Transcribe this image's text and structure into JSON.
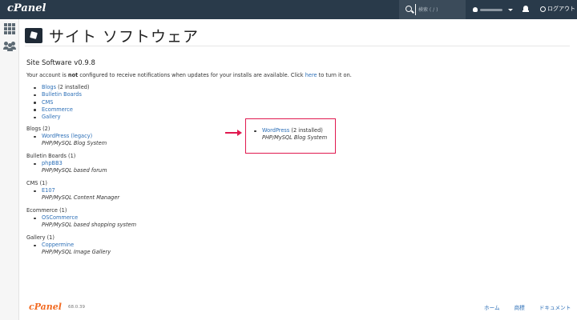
{
  "topbar": {
    "logo": "cPanel",
    "search_placeholder": "検索 ( / )",
    "logout_label": "ログアウト"
  },
  "page": {
    "title": "サイト ソフトウェア"
  },
  "main": {
    "heading": "Site Software v0.9.8",
    "notice_before": "Your account is ",
    "notice_bold": "not",
    "notice_middle": " configured to receive notifications when updates for your installs are available. Click ",
    "notice_link": "here",
    "notice_after": " to turn it on.",
    "category_links": [
      {
        "label": "Blogs",
        "suffix": " (2 installed)"
      },
      {
        "label": "Bulletin Boards",
        "suffix": ""
      },
      {
        "label": "CMS",
        "suffix": ""
      },
      {
        "label": "Ecommerce",
        "suffix": ""
      },
      {
        "label": "Gallery",
        "suffix": ""
      }
    ],
    "categories": [
      {
        "heading": "Blogs  (2)",
        "app": "WordPress (legacy)",
        "desc": "PHP/MySQL Blog System"
      },
      {
        "heading": "Bulletin Boards  (1)",
        "app": "phpBB3",
        "desc": "PHP/MySQL based forum"
      },
      {
        "heading": "CMS  (1)",
        "app": "E107",
        "desc": "PHP/MySQL Content Manager"
      },
      {
        "heading": "Ecommerce  (1)",
        "app": "OSCommerce",
        "desc": "PHP/MySQL based shopping system"
      },
      {
        "heading": "Gallery  (1)",
        "app": "Coppermine",
        "desc": "PHP/MySQL Image Gallery"
      }
    ],
    "highlight": {
      "app": "WordPress",
      "suffix": " (2 installed)",
      "desc": "PHP/MySQL Blog System"
    }
  },
  "footer": {
    "logo": "cPanel",
    "version": "68.0.39",
    "links": [
      "ホーム",
      "商標",
      "ドキュメント"
    ]
  },
  "colors": {
    "topbar": "#293a4a",
    "link": "#2c6fb7",
    "highlight": "#e0194f",
    "footer_logo": "#f26a21"
  }
}
